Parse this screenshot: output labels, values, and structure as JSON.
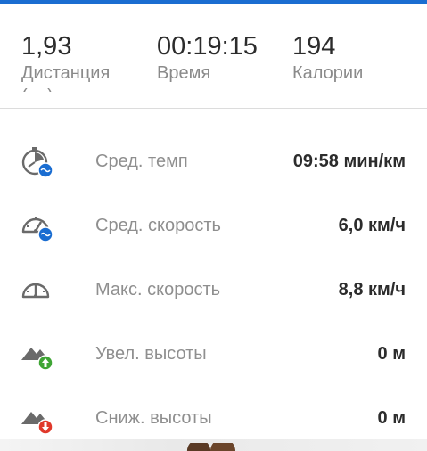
{
  "summary": {
    "distance": {
      "value": "1,93",
      "label": "Дистанция",
      "unit": "(км)"
    },
    "time": {
      "value": "00:19:15",
      "label": "Время"
    },
    "calories": {
      "value": "194",
      "label": "Калории"
    }
  },
  "metrics": [
    {
      "icon": "avg-pace-icon",
      "label": "Сред. темп",
      "value": "09:58 мин/км"
    },
    {
      "icon": "avg-speed-icon",
      "label": "Сред. скорость",
      "value": "6,0 км/ч"
    },
    {
      "icon": "max-speed-icon",
      "label": "Макс. скорость",
      "value": "8,8 км/ч"
    },
    {
      "icon": "elevation-gain-icon",
      "label": "Увел. высоты",
      "value": "0 м"
    },
    {
      "icon": "elevation-loss-icon",
      "label": "Сниж. высоты",
      "value": "0 м"
    }
  ],
  "colors": {
    "accent": "#1a6dd1",
    "badge_blue": "#1a6dd1",
    "badge_green": "#3fa535",
    "badge_red": "#e0392b",
    "icon_gray": "#6a6a6a"
  }
}
